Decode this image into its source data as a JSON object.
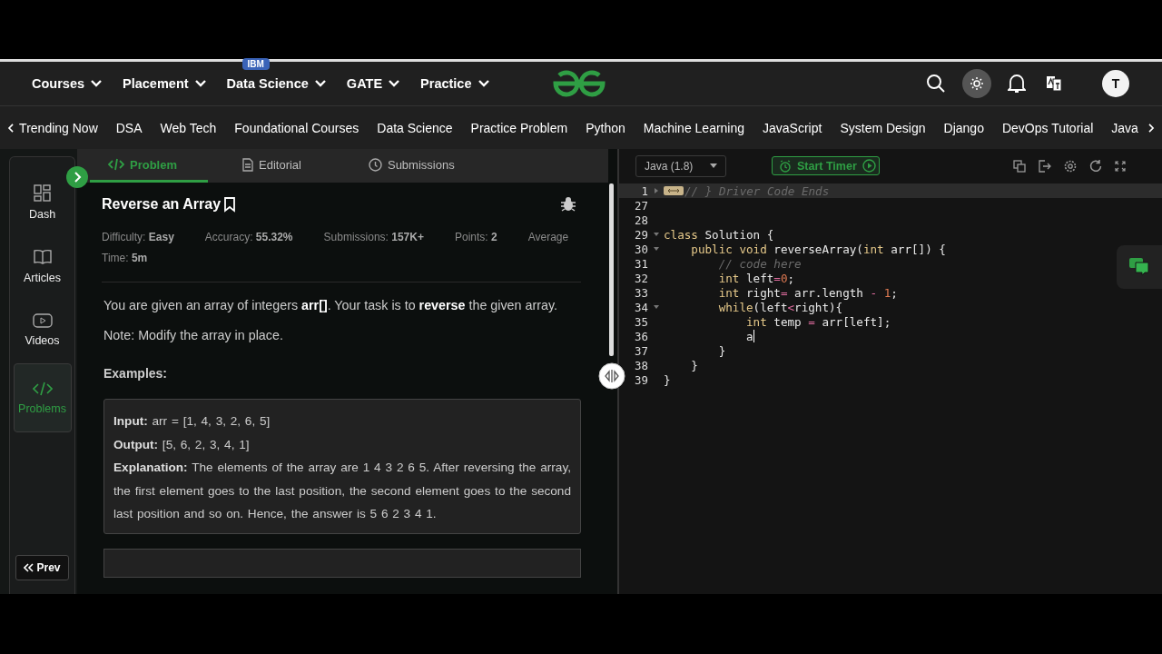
{
  "header": {
    "menu": [
      {
        "label": "Courses"
      },
      {
        "label": "Placement"
      },
      {
        "label": "Data Science",
        "badge": "IBM"
      },
      {
        "label": "GATE"
      },
      {
        "label": "Practice"
      }
    ],
    "avatar": "T"
  },
  "categories": [
    "Trending Now",
    "DSA",
    "Web Tech",
    "Foundational Courses",
    "Data Science",
    "Practice Problem",
    "Python",
    "Machine Learning",
    "JavaScript",
    "System Design",
    "Django",
    "DevOps Tutorial",
    "Java"
  ],
  "sidebar": {
    "items": [
      {
        "label": "Dash",
        "selected": false
      },
      {
        "label": "Articles",
        "selected": false
      },
      {
        "label": "Videos",
        "selected": false
      },
      {
        "label": "Problems",
        "selected": true
      }
    ],
    "prev": "Prev"
  },
  "tabs": [
    {
      "label": "Problem",
      "selected": true
    },
    {
      "label": "Editorial",
      "selected": false
    },
    {
      "label": "Submissions",
      "selected": false
    }
  ],
  "problem": {
    "title": "Reverse an Array",
    "meta": [
      "Difficulty: **Easy**",
      "Accuracy: **55.32%**",
      "Submissions: **157K+**",
      "Points: **2**",
      "Average Time: **5m**"
    ],
    "description": [
      "You are given an array of integers **arr[]**. Your task is to **reverse** the given array.",
      "Note: Modify the array in place."
    ],
    "examples_heading": "Examples:",
    "example": [
      "**Input:** arr = [1, 4, 3, 2, 6, 5]",
      "**Output:** [5, 6, 2, 3, 4, 1]",
      "**Explanation:** The elements of the array are 1 4 3 2 6 5. After reversing the array, the first element goes to the last position, the second element goes to the second last position and so on. Hence, the answer is 5 6 2 3 4 1."
    ]
  },
  "editor": {
    "language": "Java (1.8)",
    "timer": "Start Timer",
    "lines": [
      {
        "number": "1",
        "foldable": true,
        "collapsed": true,
        "cursor": false,
        "tokens": [
          {
            "kind": "comment",
            "text": "// } Driver Code Ends"
          }
        ]
      },
      {
        "number": "27",
        "foldable": false,
        "collapsed": false,
        "cursor": false
      },
      {
        "number": "28",
        "foldable": false,
        "collapsed": false,
        "cursor": false
      },
      {
        "number": "29",
        "foldable": true,
        "collapsed": false,
        "cursor": false,
        "tokens": [
          {
            "kind": "keyword",
            "text": "class"
          },
          {
            "kind": "plain",
            "text": " Solution {"
          }
        ]
      },
      {
        "number": "30",
        "foldable": true,
        "collapsed": false,
        "cursor": false,
        "tokens": [
          {
            "kind": "keyword",
            "text": "    public void"
          },
          {
            "kind": "plain",
            "text": " reverseArray("
          },
          {
            "kind": "keyword",
            "text": "int"
          },
          {
            "kind": "plain",
            "text": " arr[]) {"
          }
        ]
      },
      {
        "number": "31",
        "foldable": false,
        "collapsed": false,
        "cursor": false,
        "tokens": [
          {
            "kind": "comment",
            "text": "        // code here"
          }
        ]
      },
      {
        "number": "32",
        "foldable": false,
        "collapsed": false,
        "cursor": false,
        "tokens": [
          {
            "kind": "keyword",
            "text": "        int"
          },
          {
            "kind": "plain",
            "text": " left"
          },
          {
            "kind": "operator",
            "text": "="
          },
          {
            "kind": "number",
            "text": "0"
          },
          {
            "kind": "plain",
            "text": ";"
          }
        ]
      },
      {
        "number": "33",
        "foldable": false,
        "collapsed": false,
        "cursor": false,
        "tokens": [
          {
            "kind": "keyword",
            "text": "        int"
          },
          {
            "kind": "plain",
            "text": " right"
          },
          {
            "kind": "operator",
            "text": "="
          },
          {
            "kind": "plain",
            "text": " arr.length "
          },
          {
            "kind": "operator",
            "text": "- "
          },
          {
            "kind": "number",
            "text": "1"
          },
          {
            "kind": "plain",
            "text": ";"
          }
        ]
      },
      {
        "number": "34",
        "foldable": true,
        "collapsed": false,
        "cursor": false,
        "tokens": [
          {
            "kind": "keyword",
            "text": "        while"
          },
          {
            "kind": "plain",
            "text": "(left"
          },
          {
            "kind": "operator",
            "text": "<"
          },
          {
            "kind": "plain",
            "text": "right){"
          }
        ]
      },
      {
        "number": "35",
        "foldable": false,
        "collapsed": false,
        "cursor": false,
        "tokens": [
          {
            "kind": "keyword",
            "text": "            int"
          },
          {
            "kind": "plain",
            "text": " temp "
          },
          {
            "kind": "operator",
            "text": "="
          },
          {
            "kind": "plain",
            "text": " arr[left];"
          }
        ]
      },
      {
        "number": "36",
        "foldable": false,
        "collapsed": false,
        "cursor": true,
        "tokens": [
          {
            "kind": "plain",
            "text": "            a"
          }
        ]
      },
      {
        "number": "37",
        "foldable": false,
        "collapsed": false,
        "cursor": false,
        "tokens": [
          {
            "kind": "plain",
            "text": "        }"
          }
        ]
      },
      {
        "number": "38",
        "foldable": false,
        "collapsed": false,
        "cursor": false,
        "tokens": [
          {
            "kind": "plain",
            "text": "    }"
          }
        ]
      },
      {
        "number": "39",
        "foldable": false,
        "collapsed": false,
        "cursor": false,
        "tokens": [
          {
            "kind": "plain",
            "text": "}"
          }
        ]
      }
    ]
  }
}
